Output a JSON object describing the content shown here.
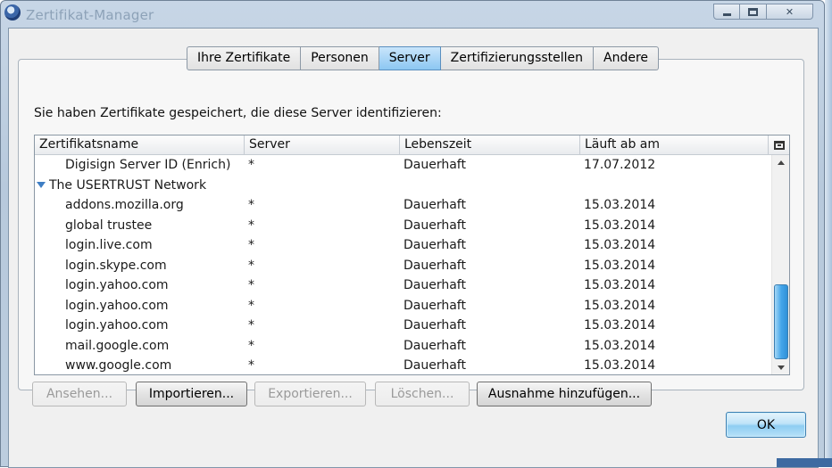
{
  "window": {
    "title": "Zertifikat-Manager",
    "controls": {
      "minimize": "minimize-icon",
      "maximize": "maximize-icon",
      "close": "close-icon"
    }
  },
  "tabs": [
    {
      "label": "Ihre Zertifikate",
      "active": false
    },
    {
      "label": "Personen",
      "active": false
    },
    {
      "label": "Server",
      "active": true
    },
    {
      "label": "Zertifizierungsstellen",
      "active": false
    },
    {
      "label": "Andere",
      "active": false
    }
  ],
  "description": "Sie haben Zertifikate gespeichert, die diese Server identifizieren:",
  "table": {
    "columns": [
      "Zertifikatsname",
      "Server",
      "Lebenszeit",
      "Läuft ab am"
    ],
    "rows": [
      {
        "type": "item",
        "name": "Digisign Server ID (Enrich)",
        "server": "*",
        "lifetime": "Dauerhaft",
        "expires": "17.07.2012"
      },
      {
        "type": "group",
        "name": "The USERTRUST Network"
      },
      {
        "type": "item",
        "name": "addons.mozilla.org",
        "server": "*",
        "lifetime": "Dauerhaft",
        "expires": "15.03.2014"
      },
      {
        "type": "item",
        "name": "global trustee",
        "server": "*",
        "lifetime": "Dauerhaft",
        "expires": "15.03.2014"
      },
      {
        "type": "item",
        "name": "login.live.com",
        "server": "*",
        "lifetime": "Dauerhaft",
        "expires": "15.03.2014"
      },
      {
        "type": "item",
        "name": "login.skype.com",
        "server": "*",
        "lifetime": "Dauerhaft",
        "expires": "15.03.2014"
      },
      {
        "type": "item",
        "name": "login.yahoo.com",
        "server": "*",
        "lifetime": "Dauerhaft",
        "expires": "15.03.2014"
      },
      {
        "type": "item",
        "name": "login.yahoo.com",
        "server": "*",
        "lifetime": "Dauerhaft",
        "expires": "15.03.2014"
      },
      {
        "type": "item",
        "name": "login.yahoo.com",
        "server": "*",
        "lifetime": "Dauerhaft",
        "expires": "15.03.2014"
      },
      {
        "type": "item",
        "name": "mail.google.com",
        "server": "*",
        "lifetime": "Dauerhaft",
        "expires": "15.03.2014"
      },
      {
        "type": "item",
        "name": "www.google.com",
        "server": "*",
        "lifetime": "Dauerhaft",
        "expires": "15.03.2014"
      }
    ]
  },
  "buttons": {
    "view": {
      "label": "Ansehen...",
      "enabled": false
    },
    "import": {
      "label": "Importieren...",
      "enabled": true
    },
    "export": {
      "label": "Exportieren...",
      "enabled": false
    },
    "delete": {
      "label": "Löschen...",
      "enabled": false
    },
    "add_exception": {
      "label": "Ausnahme hinzufügen...",
      "enabled": true
    }
  },
  "ok_label": "OK",
  "colors": {
    "tab_active": "#8cc7f2",
    "scroll_thumb": "#45a6ea"
  }
}
